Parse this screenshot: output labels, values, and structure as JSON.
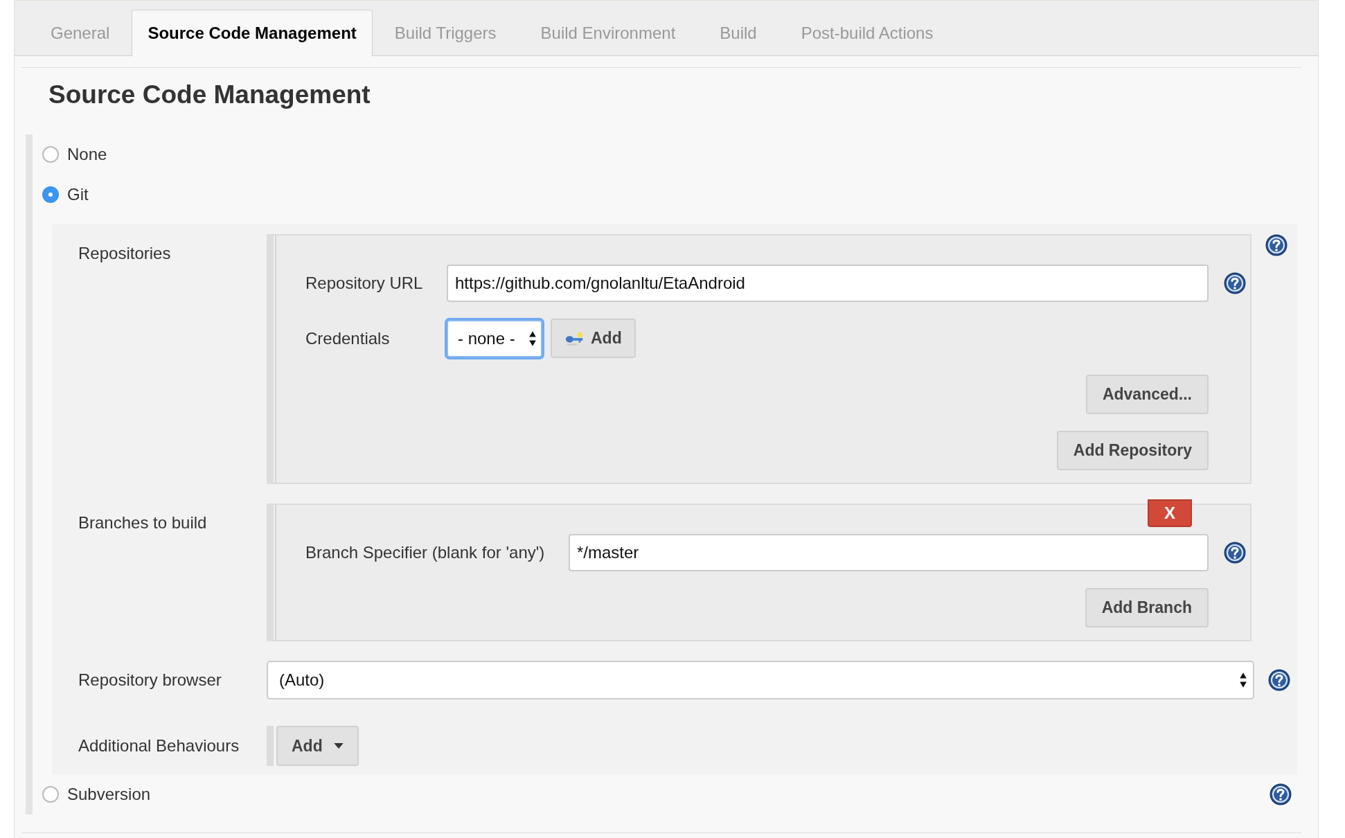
{
  "tabs": [
    {
      "label": "General",
      "selected": false
    },
    {
      "label": "Source Code Management",
      "selected": true
    },
    {
      "label": "Build Triggers",
      "selected": false
    },
    {
      "label": "Build Environment",
      "selected": false
    },
    {
      "label": "Build",
      "selected": false
    },
    {
      "label": "Post-build Actions",
      "selected": false
    }
  ],
  "heading": "Source Code Management",
  "scm_options": [
    {
      "label": "None",
      "selected": false,
      "help": false
    },
    {
      "label": "Git",
      "selected": true,
      "help": false
    },
    {
      "label": "Subversion",
      "selected": false,
      "help": true
    }
  ],
  "git": {
    "repositories": {
      "label": "Repositories",
      "url_label": "Repository URL",
      "url_value": "https://github.com/gnolanltu/EtaAndroid",
      "credentials_label": "Credentials",
      "credentials_value": "- none -",
      "credentials_focused": true,
      "credentials_add": "Add",
      "buttons": [
        "Advanced...",
        "Add Repository"
      ]
    },
    "branches": {
      "label": "Branches to build",
      "delete_button": "X",
      "specifier_label": "Branch Specifier (blank for 'any')",
      "specifier_value": "*/master",
      "button": "Add Branch"
    },
    "browser": {
      "label": "Repository browser",
      "value": "(Auto)"
    },
    "behaviours": {
      "label": "Additional Behaviours",
      "button": "Add"
    }
  }
}
